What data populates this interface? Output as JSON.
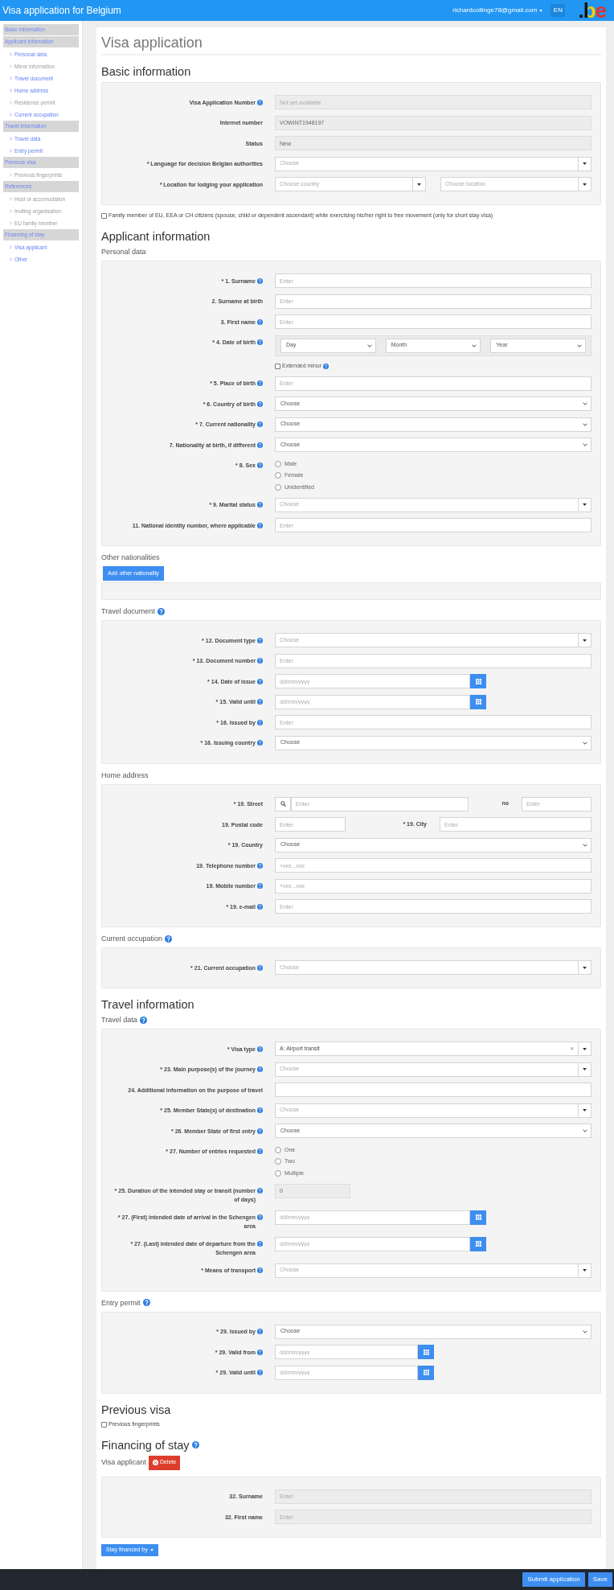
{
  "header": {
    "title": "Visa application for Belgium",
    "user_email": "richardcollinge78@gmail.com",
    "language": "EN",
    "logo": ".be"
  },
  "sidebar": [
    {
      "label": "Basic information"
    },
    {
      "label": "Applicant information",
      "children": [
        {
          "label": "Personal data",
          "disabled": false
        },
        {
          "label": "Minor information",
          "disabled": true
        },
        {
          "label": "Travel document",
          "disabled": false
        },
        {
          "label": "Home address",
          "disabled": false
        },
        {
          "label": "Residence permit",
          "disabled": true
        },
        {
          "label": "Current occupation",
          "disabled": false
        }
      ]
    },
    {
      "label": "Travel information",
      "children": [
        {
          "label": "Travel data",
          "disabled": false
        },
        {
          "label": "Entry permit",
          "disabled": false
        }
      ]
    },
    {
      "label": "Previous visa",
      "children": [
        {
          "label": "Previous fingerprints",
          "disabled": true
        }
      ]
    },
    {
      "label": "References",
      "children": [
        {
          "label": "Host or accomodation",
          "disabled": true
        },
        {
          "label": "Inviting organisation",
          "disabled": true
        },
        {
          "label": "EU family member",
          "disabled": true
        }
      ]
    },
    {
      "label": "Financing of stay",
      "children": [
        {
          "label": "Visa applicant",
          "disabled": false
        },
        {
          "label": "Other",
          "disabled": false
        }
      ]
    }
  ],
  "page_title": "Visa application",
  "sections": [
    {
      "title": "Basic information",
      "help": false,
      "blocks": [
        {
          "kind": "panel",
          "fields": [
            {
              "kind": "readonly",
              "label": "Visa Application Number",
              "help": true,
              "placeholder": "Not yet available"
            },
            {
              "kind": "readonly",
              "label": "Internet number",
              "help": false,
              "value": "VOWINT1948197"
            },
            {
              "kind": "readonly",
              "label": "Status",
              "help": false,
              "value": "New"
            },
            {
              "kind": "combo",
              "label": "* Language for decision Belgian authorities",
              "help": false,
              "placeholder": "Choose"
            },
            {
              "kind": "combo_pair",
              "label": "* Location for lodging your application",
              "help": false,
              "placeholder": "Choose country",
              "placeholder2": "Choose location"
            }
          ]
        },
        {
          "kind": "checkbox",
          "label": "Family member of EU, EEA or CH citizens (spouse, child or dependent ascendant) while exercising his/her right to free movement (only for short stay visa)",
          "checked": false
        }
      ]
    },
    {
      "title": "Applicant information",
      "help": false,
      "blocks": [
        {
          "kind": "subheading",
          "title": "Personal data",
          "help": false
        },
        {
          "kind": "panel",
          "fields": [
            {
              "kind": "text",
              "label": "* 1. Surname",
              "help": true,
              "placeholder": "Enter"
            },
            {
              "kind": "text",
              "label": "2. Surname at birth",
              "help": false,
              "placeholder": "Enter"
            },
            {
              "kind": "text",
              "label": "3. First name",
              "help": true,
              "placeholder": "Enter"
            },
            {
              "kind": "date_parts",
              "label": "* 4. Date of birth",
              "help": true,
              "parts": [
                "Day",
                "Month",
                "Year"
              ]
            },
            {
              "kind": "checkbox",
              "label": "Extended minor",
              "help": true,
              "checked": false
            },
            {
              "kind": "text",
              "label": "* 5. Place of birth",
              "help": true,
              "placeholder": "Enter"
            },
            {
              "kind": "select",
              "label": "* 6. Country of birth",
              "help": true,
              "placeholder": "Choose"
            },
            {
              "kind": "select",
              "label": "* 7. Current nationality",
              "help": true,
              "placeholder": "Choose"
            },
            {
              "kind": "select",
              "label": "7. Nationality at birth, if different",
              "help": true,
              "placeholder": "Choose"
            },
            {
              "kind": "radio",
              "label": "* 8. Sex",
              "help": true,
              "options": [
                {
                  "label": "Male",
                  "selected": false
                },
                {
                  "label": "Female",
                  "selected": false
                },
                {
                  "label": "Unidentified",
                  "selected": false
                }
              ]
            },
            {
              "kind": "combo",
              "label": "* 9. Marital status",
              "help": true,
              "placeholder": "Choose"
            },
            {
              "kind": "text",
              "label": "11. National identity number, where applicable",
              "help": true,
              "placeholder": "Enter"
            }
          ]
        },
        {
          "kind": "subheading",
          "title": "Other nationalities",
          "help": false
        },
        {
          "kind": "button",
          "label": "Add other nationality"
        },
        {
          "kind": "empty_panel"
        },
        {
          "kind": "subheading",
          "title": "Travel document",
          "help": true
        },
        {
          "kind": "panel",
          "fields": [
            {
              "kind": "combo",
              "label": "* 12. Document type",
              "help": true,
              "placeholder": "Choose"
            },
            {
              "kind": "text",
              "label": "* 13. Document number",
              "help": true,
              "placeholder": "Enter"
            },
            {
              "kind": "date",
              "label": "* 14. Date of issue",
              "help": true,
              "placeholder": "dd/mm/yyyy"
            },
            {
              "kind": "date",
              "label": "* 15. Valid until",
              "help": true,
              "placeholder": "dd/mm/yyyy"
            },
            {
              "kind": "text",
              "label": "* 16. Issued by",
              "help": true,
              "placeholder": "Enter"
            },
            {
              "kind": "select",
              "label": "* 16. Issuing country",
              "help": true,
              "placeholder": "Choose"
            }
          ]
        },
        {
          "kind": "subheading",
          "title": "Home address",
          "help": false
        },
        {
          "kind": "panel",
          "fields": [
            {
              "kind": "street",
              "label": "* 19. Street",
              "help": false,
              "placeholder": "Enter",
              "label2": "no",
              "placeholder2": "Enter"
            },
            {
              "kind": "split",
              "label": "19. Postal code",
              "help": false,
              "placeholder": "Enter",
              "label2": "* 19. City",
              "placeholder2": "Enter"
            },
            {
              "kind": "select",
              "label": "* 19. Country",
              "help": false,
              "placeholder": "Choose"
            },
            {
              "kind": "text",
              "label": "19. Telephone number",
              "help": true,
              "placeholder": "+xxx...xxx"
            },
            {
              "kind": "text",
              "label": "19. Mobile number",
              "help": true,
              "placeholder": "+xxx...xxx"
            },
            {
              "kind": "text",
              "label": "* 19. e-mail",
              "help": true,
              "placeholder": "Enter"
            }
          ]
        },
        {
          "kind": "subheading",
          "title": "Current occupation",
          "help": true
        },
        {
          "kind": "panel",
          "fields": [
            {
              "kind": "combo",
              "label": "* 21. Current occupation",
              "help": true,
              "placeholder": "Choose"
            }
          ]
        }
      ]
    },
    {
      "title": "Travel information",
      "help": false,
      "blocks": [
        {
          "kind": "subheading",
          "title": "Travel data",
          "help": true
        },
        {
          "kind": "panel",
          "fields": [
            {
              "kind": "combo",
              "label": "* Visa type",
              "help": true,
              "value": "A: Airport transit",
              "clear": "×"
            },
            {
              "kind": "combo",
              "label": "* 23. Main purpose(s) of the journey",
              "help": true,
              "placeholder": "Choose"
            },
            {
              "kind": "text",
              "label": "24. Additional information on the purpose of travel",
              "help": false
            },
            {
              "kind": "combo",
              "label": "* 25. Member State(s) of destination",
              "help": true,
              "placeholder": "Choose"
            },
            {
              "kind": "select",
              "label": "* 26. Member State of first entry",
              "help": true,
              "placeholder": "Choose"
            },
            {
              "kind": "radio",
              "label": "* 27. Number of entries requested",
              "help": true,
              "options": [
                {
                  "label": "One",
                  "selected": false
                },
                {
                  "label": "Two",
                  "selected": false
                },
                {
                  "label": "Multiple",
                  "selected": false
                }
              ]
            },
            {
              "kind": "readonly_short",
              "label": "* 25. Duration of the intended stay or transit (number of days)",
              "help": true,
              "value": "0"
            },
            {
              "kind": "date",
              "label": "* 27. (First) intended date of arrival in the Schengen area",
              "help": true,
              "placeholder": "dd/mm/yyyy"
            },
            {
              "kind": "date",
              "label": "* 27. (Last) intended date of departure from the Schengen area",
              "help": true,
              "placeholder": "dd/mm/yyyy"
            },
            {
              "kind": "combo",
              "label": "* Means of transport",
              "help": true,
              "placeholder": "Choose"
            }
          ]
        },
        {
          "kind": "subheading",
          "title": "Entry permit",
          "help": true
        },
        {
          "kind": "panel",
          "fields": [
            {
              "kind": "select",
              "label": "* 29. Issued by",
              "help": true,
              "placeholder": "Choose"
            },
            {
              "kind": "date_narrow",
              "label": "* 29. Valid from",
              "help": true,
              "placeholder": "dd/mm/yyyy"
            },
            {
              "kind": "date_narrow",
              "label": "* 29. Valid until",
              "help": true,
              "placeholder": "dd/mm/yyyy"
            }
          ]
        }
      ]
    },
    {
      "title": "Previous visa",
      "help": false,
      "blocks": [
        {
          "kind": "checkbox",
          "label": "Previous fingerprints",
          "checked": false
        }
      ]
    },
    {
      "title": "Financing of stay",
      "help": true,
      "blocks": [
        {
          "kind": "applicant_bar",
          "title": "Visa applicant",
          "button": "Delete"
        },
        {
          "kind": "panel",
          "fields": [
            {
              "kind": "readonly",
              "label": "32. Surname",
              "help": false,
              "placeholder": "Enter"
            },
            {
              "kind": "readonly",
              "label": "32. First name",
              "help": false,
              "placeholder": "Enter"
            }
          ]
        },
        {
          "kind": "dropdown_button",
          "label": "Stay financed by"
        }
      ]
    }
  ],
  "footer_buttons": [
    "Submit application",
    "Save"
  ]
}
